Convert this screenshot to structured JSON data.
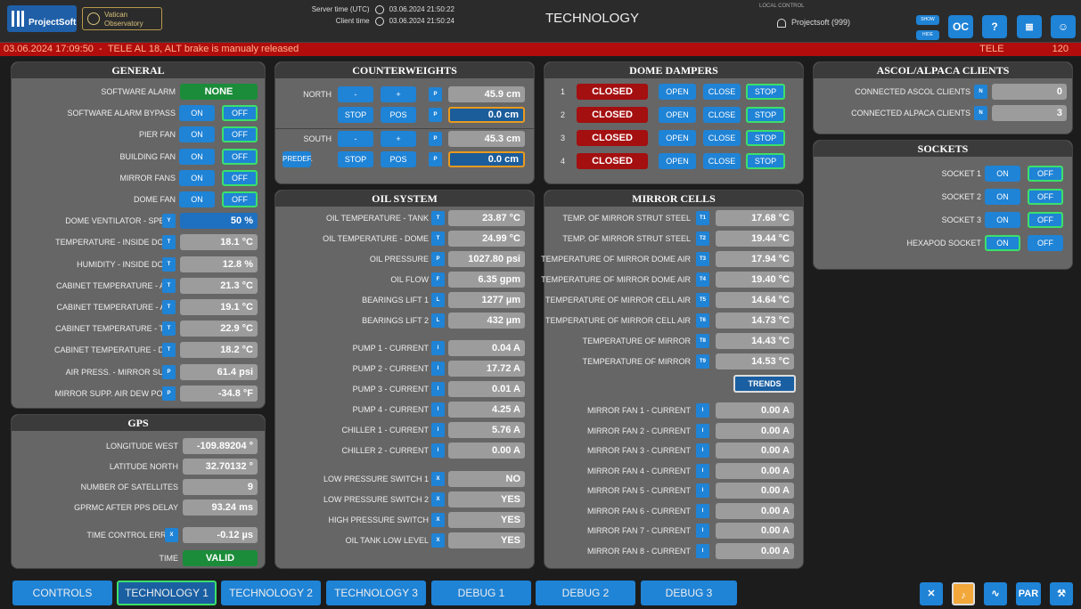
{
  "header": {
    "logo": "ProjectSoft",
    "observatory_line1": "Vatican",
    "observatory_line2": "Observatory",
    "server_time_label": "Server time (UTC)",
    "server_time": "03.06.2024 21:50:22",
    "client_time_label": "Client time",
    "client_time": "03.06.2024 21:50:24",
    "title": "TECHNOLOGY",
    "local_control": "LOCAL CONTROL",
    "user": "Projectsoft (999)",
    "show": "SHOW",
    "hide": "HIDE",
    "help": "?"
  },
  "alarm": {
    "time": "03.06.2024 17:09:50",
    "message": "TELE AL 18, ALT brake is manualy released",
    "source": "TELE",
    "code": "120"
  },
  "general": {
    "title": "GENERAL",
    "rows": [
      {
        "label": "SOFTWARE ALARM",
        "value": "NONE"
      },
      {
        "label": "SOFTWARE ALARM BYPASS",
        "on": "ON",
        "off": "OFF"
      },
      {
        "label": "PIER FAN",
        "on": "ON",
        "off": "OFF"
      },
      {
        "label": "BUILDING FAN",
        "on": "ON",
        "off": "OFF"
      },
      {
        "label": "MIRROR FANS",
        "on": "ON",
        "off": "OFF"
      },
      {
        "label": "DOME FAN",
        "on": "ON",
        "off": "OFF"
      },
      {
        "label": "DOME VENTILATOR - SPEED",
        "tag": "Y",
        "value": "50 %"
      },
      {
        "label": "TEMPERATURE - INSIDE DOME",
        "tag": "T",
        "value": "18.1 °C"
      },
      {
        "label": "HUMIDITY - INSIDE DOME",
        "tag": "T",
        "value": "12.8 %"
      },
      {
        "label": "CABINET TEMPERATURE - AZC",
        "tag": "T",
        "value": "21.3 °C"
      },
      {
        "label": "CABINET TEMPERATURE - ALC",
        "tag": "T",
        "value": "19.1 °C"
      },
      {
        "label": "CABINET TEMPERATURE - TCC",
        "tag": "T",
        "value": "22.9 °C"
      },
      {
        "label": "CABINET TEMPERATURE - DCC",
        "tag": "T",
        "value": "18.2 °C"
      },
      {
        "label": "AIR PRESS. - MIRROR SUPP.",
        "tag": "P",
        "value": "61.4 psi"
      },
      {
        "label": "MIRROR SUPP. AIR DEW POINT",
        "tag": "P",
        "value": "-34.8 °F"
      }
    ]
  },
  "gps": {
    "title": "GPS",
    "rows": [
      {
        "label": "LONGITUDE WEST",
        "value": "-109.89204 °"
      },
      {
        "label": "LATITUDE NORTH",
        "value": "32.70132 °"
      },
      {
        "label": "NUMBER OF SATELLITES",
        "value": "9"
      },
      {
        "label": "GPRMC AFTER PPS DELAY",
        "value": "93.24 ms"
      },
      {
        "label": "TIME CONTROL ERROR",
        "tag": "X",
        "value": "-0.12 µs"
      },
      {
        "label": "TIME",
        "value": "VALID"
      }
    ]
  },
  "counterweights": {
    "title": "COUNTERWEIGHTS",
    "north": "NORTH",
    "south": "SOUTH",
    "minus": "-",
    "plus": "+",
    "p": "P",
    "stop": "STOP",
    "pos": "POS",
    "predef": "PREDEF.",
    "north_value": "45.9 cm",
    "north_target": "0.0 cm",
    "south_value": "45.3 cm",
    "south_target": "0.0 cm"
  },
  "oil": {
    "title": "OIL SYSTEM",
    "rows": [
      {
        "label": "OIL TEMPERATURE - TANK",
        "tag": "T",
        "value": "23.87 °C"
      },
      {
        "label": "OIL TEMPERATURE - DOME",
        "tag": "T",
        "value": "24.99 °C"
      },
      {
        "label": "OIL PRESSURE",
        "tag": "P",
        "value": "1027.80 psi"
      },
      {
        "label": "OIL FLOW",
        "tag": "F",
        "value": "6.35 gpm"
      },
      {
        "label": "BEARINGS LIFT 1",
        "tag": "L",
        "value": "1277 µm"
      },
      {
        "label": "BEARINGS LIFT 2",
        "tag": "L",
        "value": "432 µm"
      },
      {
        "label": "PUMP 1 - CURRENT",
        "tag": "I",
        "value": "0.04 A"
      },
      {
        "label": "PUMP 2 - CURRENT",
        "tag": "I",
        "value": "17.72 A"
      },
      {
        "label": "PUMP 3 - CURRENT",
        "tag": "I",
        "value": "0.01 A"
      },
      {
        "label": "PUMP 4 - CURRENT",
        "tag": "I",
        "value": "4.25 A"
      },
      {
        "label": "CHILLER 1 - CURRENT",
        "tag": "I",
        "value": "5.76 A"
      },
      {
        "label": "CHILLER 2 - CURRENT",
        "tag": "I",
        "value": "0.00 A"
      },
      {
        "label": "LOW PRESSURE SWITCH 1",
        "tag": "X",
        "value": "NO"
      },
      {
        "label": "LOW PRESSURE SWITCH 2",
        "tag": "X",
        "value": "YES"
      },
      {
        "label": "HIGH PRESSURE SWITCH",
        "tag": "X",
        "value": "YES"
      },
      {
        "label": "OIL TANK LOW LEVEL",
        "tag": "X",
        "value": "YES"
      }
    ]
  },
  "dampers": {
    "title": "DOME DAMPERS",
    "open": "OPEN",
    "close": "CLOSE",
    "stop": "STOP",
    "rows": [
      {
        "num": "1",
        "state": "CLOSED"
      },
      {
        "num": "2",
        "state": "CLOSED"
      },
      {
        "num": "3",
        "state": "CLOSED"
      },
      {
        "num": "4",
        "state": "CLOSED"
      }
    ]
  },
  "mirror": {
    "title": "MIRROR CELLS",
    "trends": "TRENDS",
    "temps": [
      {
        "label": "TEMP. OF MIRROR STRUT STEEL",
        "tag": "T1",
        "value": "17.68 °C"
      },
      {
        "label": "TEMP. OF MIRROR STRUT STEEL",
        "tag": "T2",
        "value": "19.44 °C"
      },
      {
        "label": "TEMPERATURE OF MIRROR DOME AIR",
        "tag": "T3",
        "value": "17.94 °C"
      },
      {
        "label": "TEMPERATURE OF MIRROR DOME AIR",
        "tag": "T4",
        "value": "19.40 °C"
      },
      {
        "label": "TEMPERATURE OF MIRROR CELL AIR",
        "tag": "T5",
        "value": "14.64 °C"
      },
      {
        "label": "TEMPERATURE OF MIRROR CELL AIR",
        "tag": "T6",
        "value": "14.73 °C"
      },
      {
        "label": "TEMPERATURE OF MIRROR",
        "tag": "T8",
        "value": "14.43 °C"
      },
      {
        "label": "TEMPERATURE OF MIRROR",
        "tag": "T9",
        "value": "14.53 °C"
      }
    ],
    "fans": [
      {
        "label": "MIRROR FAN 1 - CURRENT",
        "tag": "I",
        "value": "0.00 A"
      },
      {
        "label": "MIRROR FAN 2 - CURRENT",
        "tag": "I",
        "value": "0.00 A"
      },
      {
        "label": "MIRROR FAN 3 - CURRENT",
        "tag": "I",
        "value": "0.00 A"
      },
      {
        "label": "MIRROR FAN 4 - CURRENT",
        "tag": "I",
        "value": "0.00 A"
      },
      {
        "label": "MIRROR FAN 5 - CURRENT",
        "tag": "I",
        "value": "0.00 A"
      },
      {
        "label": "MIRROR FAN 6 - CURRENT",
        "tag": "I",
        "value": "0.00 A"
      },
      {
        "label": "MIRROR FAN 7 - CURRENT",
        "tag": "I",
        "value": "0.00 A"
      },
      {
        "label": "MIRROR FAN 8 - CURRENT",
        "tag": "I",
        "value": "0.00 A"
      }
    ]
  },
  "ascol": {
    "title": "ASCOL/ALPACA CLIENTS",
    "rows": [
      {
        "label": "CONNECTED ASCOL CLIENTS",
        "tag": "N",
        "value": "0"
      },
      {
        "label": "CONNECTED ALPACA CLIENTS",
        "tag": "N",
        "value": "3"
      }
    ]
  },
  "sockets": {
    "title": "SOCKETS",
    "rows": [
      {
        "label": "SOCKET 1",
        "on": "ON",
        "off": "OFF"
      },
      {
        "label": "SOCKET 2",
        "on": "ON",
        "off": "OFF"
      },
      {
        "label": "SOCKET 3",
        "on": "ON",
        "off": "OFF"
      },
      {
        "label": "HEXAPOD SOCKET",
        "on": "ON",
        "off": "OFF"
      }
    ]
  },
  "tabs": [
    "CONTROLS",
    "TECHNOLOGY 1",
    "TECHNOLOGY 2",
    "TECHNOLOGY 3",
    "DEBUG 1",
    "DEBUG 2",
    "DEBUG 3"
  ],
  "par": "PAR",
  "colors": {
    "accent": "#1f83d6",
    "selected_border": "#3be06a",
    "alarm": "#b10d0d",
    "closed": "#a40f10",
    "ok": "#1b8c3a"
  }
}
